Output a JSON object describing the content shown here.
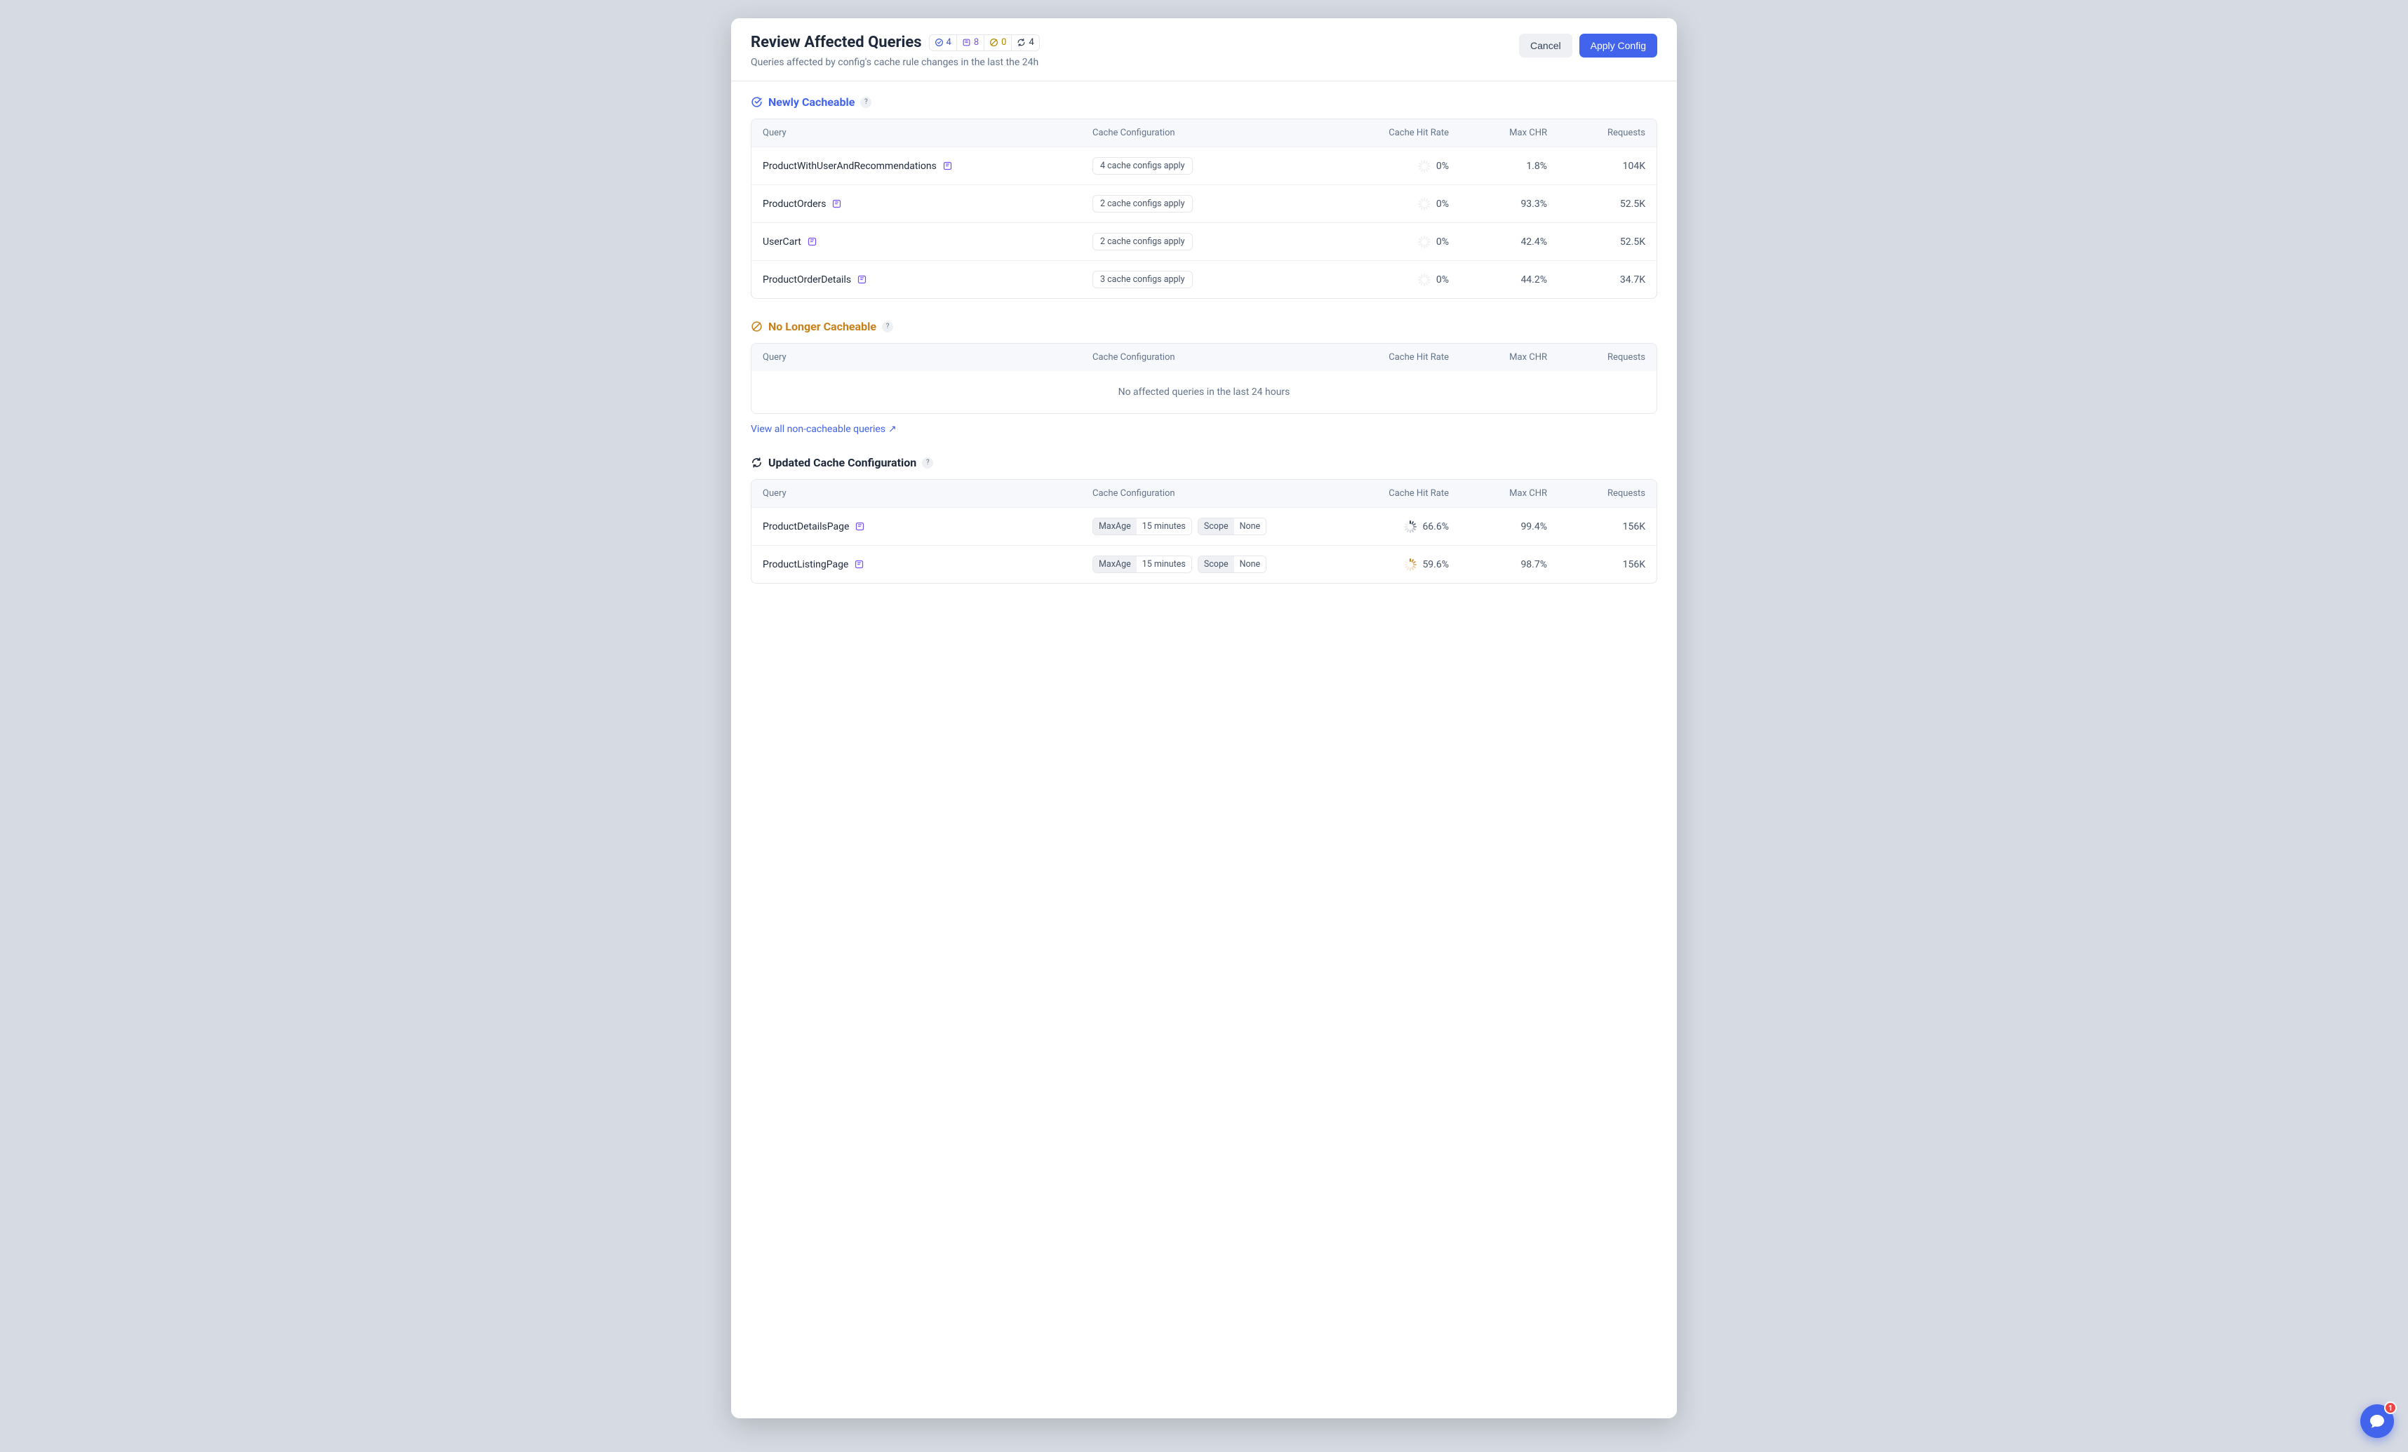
{
  "modal": {
    "title": "Review Affected Queries",
    "subtitle": "Queries affected by config's cache rule changes in the last the 24h",
    "badges": {
      "newly_cacheable": 4,
      "cache_configs": 8,
      "no_longer_cacheable": 0,
      "updated": 4
    },
    "actions": {
      "cancel": "Cancel",
      "apply": "Apply Config"
    }
  },
  "columns": {
    "query": "Query",
    "config": "Cache Configuration",
    "chr": "Cache Hit Rate",
    "max": "Max CHR",
    "requests": "Requests"
  },
  "sections": {
    "newly": {
      "title": "Newly Cacheable",
      "rows": [
        {
          "name": "ProductWithUserAndRecommendations",
          "config": "4 cache configs apply",
          "chr": "0%",
          "spinner": "gray",
          "max": "1.8%",
          "requests": "104K"
        },
        {
          "name": "ProductOrders",
          "config": "2 cache configs apply",
          "chr": "0%",
          "spinner": "gray",
          "max": "93.3%",
          "requests": "52.5K"
        },
        {
          "name": "UserCart",
          "config": "2 cache configs apply",
          "chr": "0%",
          "spinner": "gray",
          "max": "42.4%",
          "requests": "52.5K"
        },
        {
          "name": "ProductOrderDetails",
          "config": "3 cache configs apply",
          "chr": "0%",
          "spinner": "gray",
          "max": "44.2%",
          "requests": "34.7K"
        }
      ]
    },
    "no_longer": {
      "title": "No Longer Cacheable",
      "empty": "No affected queries in the last 24 hours",
      "link": "View all non-cacheable queries"
    },
    "updated": {
      "title": "Updated Cache Configuration",
      "rows": [
        {
          "name": "ProductDetailsPage",
          "tags": [
            {
              "k": "MaxAge",
              "v": "15 minutes"
            },
            {
              "k": "Scope",
              "v": "None"
            }
          ],
          "chr": "66.6%",
          "spinner": "dark",
          "max": "99.4%",
          "requests": "156K"
        },
        {
          "name": "ProductListingPage",
          "tags": [
            {
              "k": "MaxAge",
              "v": "15 minutes"
            },
            {
              "k": "Scope",
              "v": "None"
            }
          ],
          "chr": "59.6%",
          "spinner": "orange",
          "max": "98.7%",
          "requests": "156K"
        }
      ]
    }
  },
  "chat": {
    "unread": 1
  }
}
